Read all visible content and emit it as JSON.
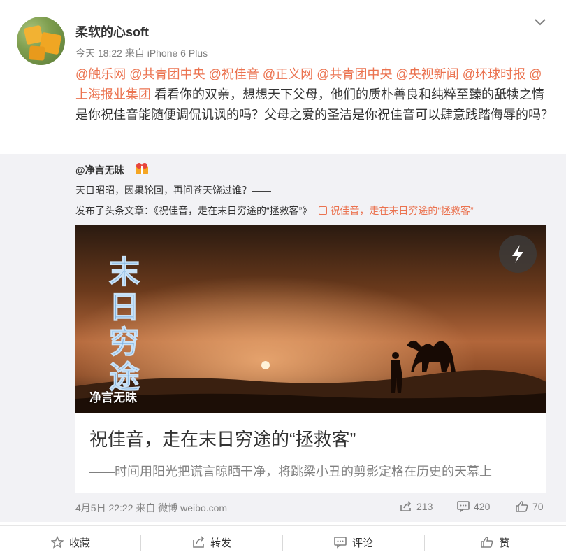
{
  "post": {
    "username": "柔软的心soft",
    "meta": "今天 18:22 来自 iPhone 6 Plus",
    "mentions_line1": [
      "@触乐网",
      "@共青团中央",
      "@祝佳音",
      "@正义网",
      "@共青团中央",
      "@央视新闻",
      "@环球时"
    ],
    "line2_mention_a": "报",
    "line2_mention_b": "@上海报业集团",
    "line2_text": " 看看你的双亲，想想天下父母，他们的质朴善良和纯粹至臻的",
    "line3_text": "舐犊之情是你祝佳音能随便调侃讥讽的吗？父母之爱的圣洁是你祝佳音可以肆意",
    "line4_text": "践踏侮辱的吗？"
  },
  "retweet": {
    "user": "@净言无昧",
    "line1": "天日昭昭，因果轮回，再问苍天饶过谁？——",
    "line2_prefix": "发布了头条文章：《祝佳音，走在末日穷途的“拯救客”》",
    "line2_link": "祝佳音，走在末日穷途的“拯救客”",
    "card": {
      "image_title": "末日穷途",
      "watermark": "净言无昧",
      "title": "祝佳音，走在末日穷途的“拯救客”",
      "subtitle": "——时间用阳光把谎言晾晒干净，将跳梁小丑的剪影定格在历史的天幕上"
    },
    "date": "4月5日 22:22 来自 微博 weibo.com",
    "stats": {
      "reposts": "213",
      "comments": "420",
      "likes": "70"
    }
  },
  "actions": {
    "favorite": "收藏",
    "repost": "转发",
    "comment": "评论",
    "like": "赞"
  },
  "colors": {
    "accent": "#eb7350",
    "muted": "#808080",
    "retweet_bg": "#f2f2f5"
  }
}
